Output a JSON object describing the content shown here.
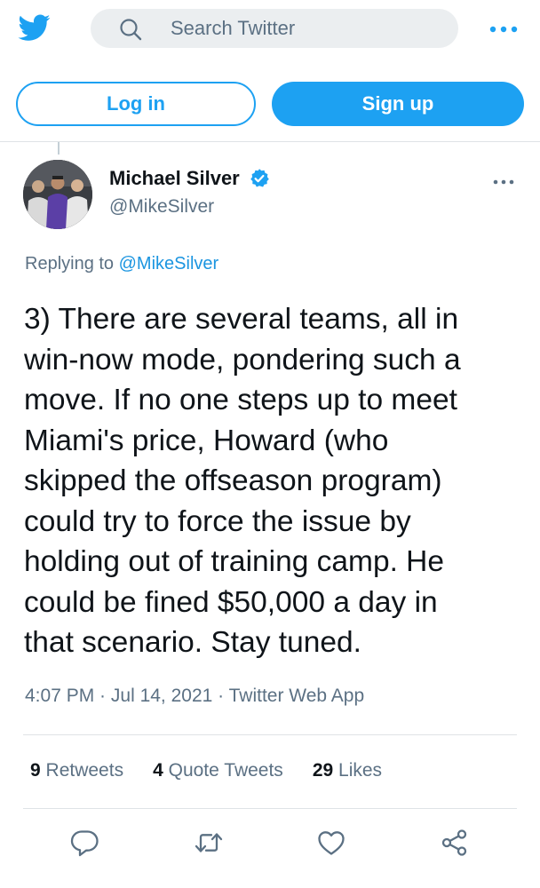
{
  "header": {
    "logo_icon": "twitter-bird-icon",
    "search_placeholder": "Search Twitter",
    "more_icon": "more-horizontal-icon",
    "accent_color": "#1da1f2"
  },
  "auth": {
    "login_label": "Log in",
    "signup_label": "Sign up"
  },
  "tweet": {
    "author_name": "Michael Silver",
    "author_handle": "@MikeSilver",
    "verified": true,
    "replying_prefix": "Replying to ",
    "replying_to": "@MikeSilver",
    "text": "3) There are several teams, all in\nwin-now mode, pondering such a\nmove. If no one steps up to meet\nMiami's price, Howard (who\nskipped the offseason program)\ncould try to force the issue by\nholding out of training camp. He\ncould be fined $50,000 a day in\nthat scenario. Stay tuned.",
    "time": "4:07 PM",
    "date": "Jul 14, 2021",
    "source": "Twitter Web App",
    "sep": " · "
  },
  "stats": {
    "retweets_count": "9",
    "retweets_label": "Retweets",
    "quotes_count": "4",
    "quotes_label": "Quote Tweets",
    "likes_count": "29",
    "likes_label": "Likes"
  },
  "actions": [
    "reply-icon",
    "retweet-icon",
    "like-icon",
    "share-icon"
  ]
}
